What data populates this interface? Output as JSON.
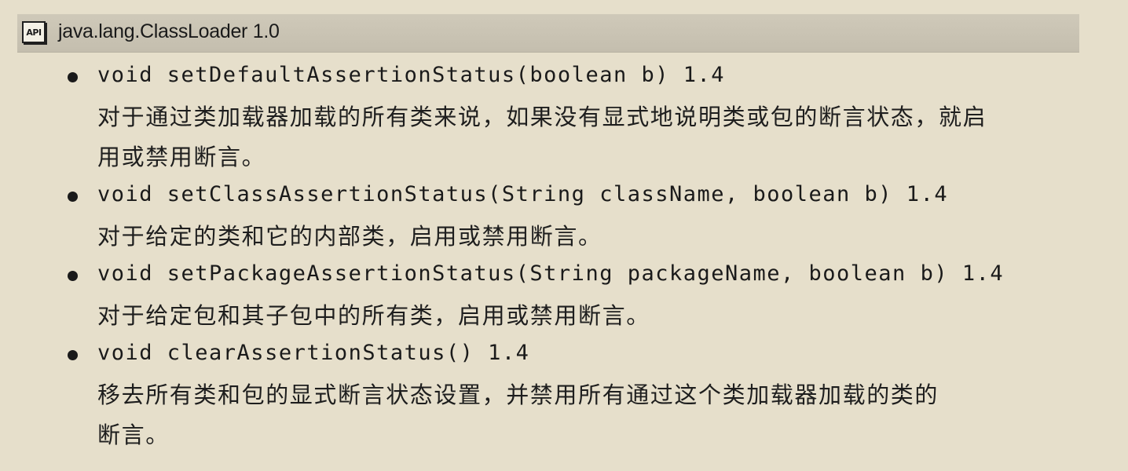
{
  "header": {
    "badge": "API",
    "title": "java.lang.ClassLoader 1.0"
  },
  "methods": [
    {
      "signature": "void setDefaultAssertionStatus(boolean b) 1.4",
      "desc_lines": [
        "对于通过类加载器加载的所有类来说，如果没有显式地说明类或包的断言状态，就启",
        "用或禁用断言。"
      ]
    },
    {
      "signature": "void setClassAssertionStatus(String className, boolean b) 1.4",
      "desc_lines": [
        "对于给定的类和它的内部类，启用或禁用断言。"
      ]
    },
    {
      "signature": "void setPackageAssertionStatus(String packageName, boolean b) 1.4",
      "desc_lines": [
        "对于给定包和其子包中的所有类，启用或禁用断言。"
      ]
    },
    {
      "signature": "void clearAssertionStatus() 1.4",
      "desc_lines": [
        "移去所有类和包的显式断言状态设置，并禁用所有通过这个类加载器加载的类的",
        "断言。"
      ]
    }
  ]
}
